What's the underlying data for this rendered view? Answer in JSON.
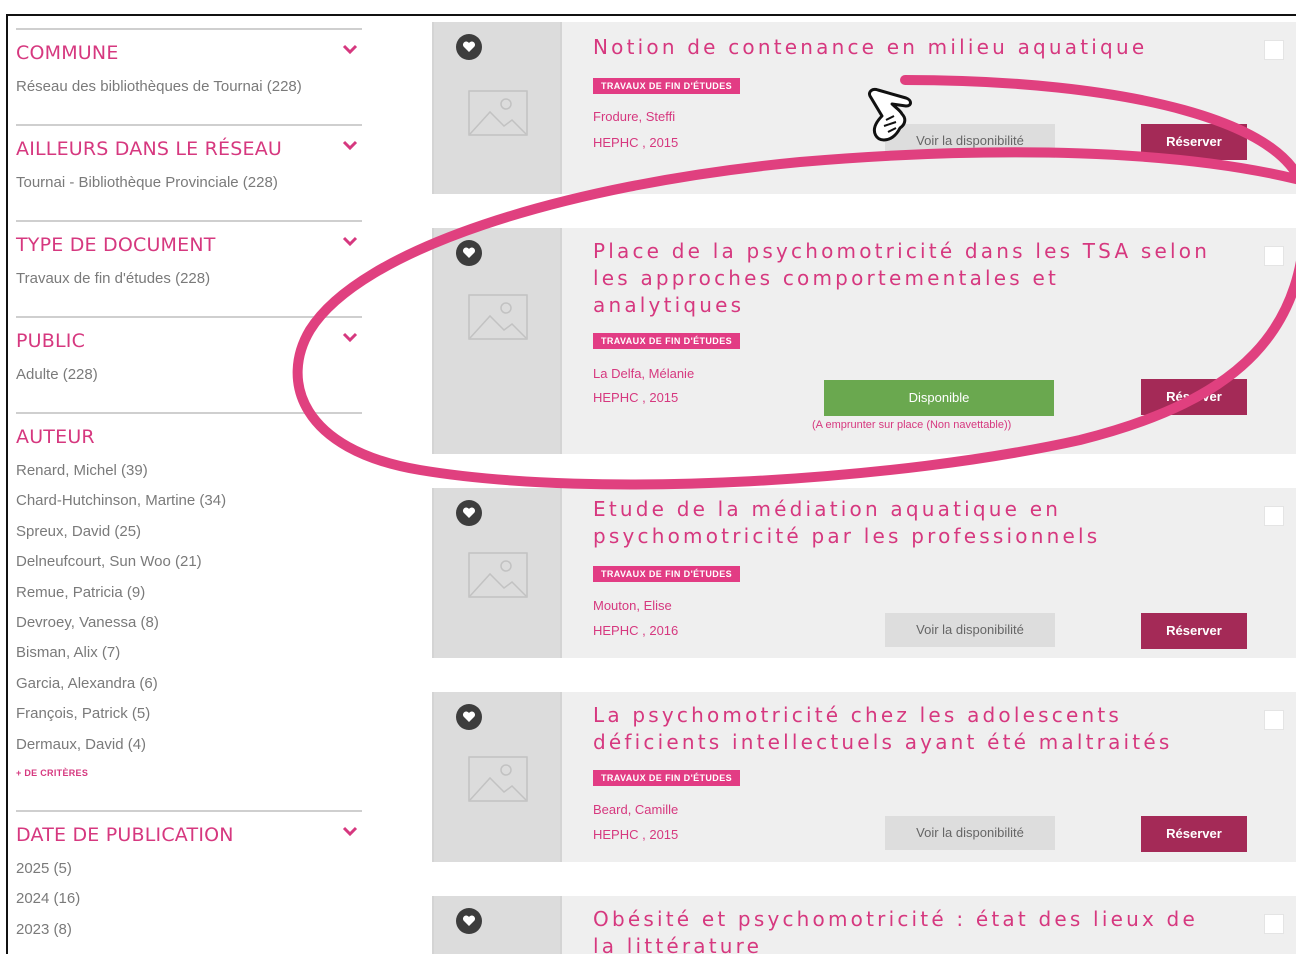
{
  "sidebar": {
    "facets": [
      {
        "label": "COMMUNE",
        "items": [
          "Réseau des bibliothèques de Tournai (228)"
        ]
      },
      {
        "label": "AILLEURS DANS LE RÉSEAU",
        "items": [
          "Tournai - Bibliothèque Provinciale (228)"
        ]
      },
      {
        "label": "TYPE DE DOCUMENT",
        "items": [
          "Travaux de fin d'études (228)"
        ]
      },
      {
        "label": "PUBLIC",
        "items": [
          "Adulte (228)"
        ]
      },
      {
        "label": "AUTEUR",
        "items": [
          "Renard, Michel (39)",
          "Chard-Hutchinson, Martine (34)",
          "Spreux, David (25)",
          "Delneufcourt, Sun Woo (21)",
          "Remue, Patricia (9)",
          "Devroey, Vanessa (8)",
          "Bisman, Alix (7)",
          "Garcia, Alexandra (6)",
          "François, Patrick (5)",
          "Dermaux, David (4)"
        ],
        "more": "+ DE CRITÈRES"
      },
      {
        "label": "DATE DE PUBLICATION",
        "items": [
          "2025 (5)",
          "2024 (16)",
          "2023 (8)"
        ]
      }
    ]
  },
  "results": [
    {
      "title": "Notion de contenance en milieu aquatique",
      "badge": "TRAVAUX DE FIN D'ÉTUDES",
      "author": "Frodure, Steffi",
      "publisher": "HEPHC , 2015",
      "availability": "Voir la disponibilité",
      "reserve": "Réserver"
    },
    {
      "title": "Place de la psychomotricité dans les TSA selon les approches comportementales et analytiques",
      "badge": "TRAVAUX DE FIN D'ÉTUDES",
      "author": "La Delfa, Mélanie",
      "publisher": "HEPHC , 2015",
      "availability": "Disponible",
      "availability_note": "(A emprunter sur place (Non navettable))",
      "reserve": "Réserver"
    },
    {
      "title": "Etude de la médiation aquatique en psychomotricité par les professionnels",
      "badge": "TRAVAUX DE FIN D'ÉTUDES",
      "author": "Mouton, Elise",
      "publisher": "HEPHC , 2016",
      "availability": "Voir la disponibilité",
      "reserve": "Réserver"
    },
    {
      "title": "La psychomotricité chez les adolescents déficients intellectuels ayant été maltraités",
      "badge": "TRAVAUX DE FIN D'ÉTUDES",
      "author": "Beard, Camille",
      "publisher": "HEPHC , 2015",
      "availability": "Voir la disponibilité",
      "reserve": "Réserver"
    },
    {
      "title": "Obésité et psychomotricité : état des lieux de la littérature"
    }
  ],
  "colors": {
    "accent": "#d6387f",
    "badge": "#e23c84",
    "reserve": "#a42a57",
    "available": "#6aa84f",
    "annotation": "#e0407f"
  },
  "icons": {
    "facet_toggle": "chevron-down-icon",
    "favorite": "heart-icon",
    "thumbnail": "image-placeholder-icon",
    "pointer": "pointing-hand-icon"
  }
}
